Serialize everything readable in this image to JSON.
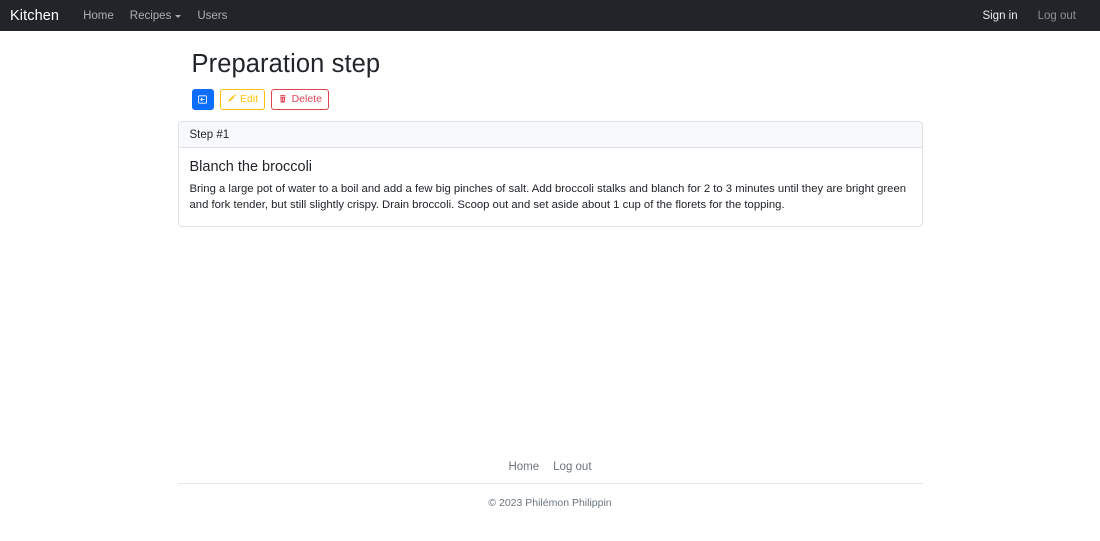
{
  "navbar": {
    "brand": "Kitchen",
    "links": [
      {
        "label": "Home",
        "icon": "",
        "has_caret": false
      },
      {
        "label": "Recipes",
        "icon": "chevron-down-icon",
        "has_caret": true
      },
      {
        "label": "Users",
        "icon": "",
        "has_caret": false
      }
    ],
    "right": [
      {
        "label": "Sign in",
        "state": "active"
      },
      {
        "label": "Log out",
        "state": "muted"
      }
    ],
    "background_color": "#212529"
  },
  "page": {
    "title": "Preparation step"
  },
  "actions": {
    "back_label": "",
    "back_icon": "box-arrow-left-icon",
    "edit_label": "Edit",
    "edit_icon": "pencil-icon",
    "delete_label": "Delete",
    "delete_icon": "trash-icon",
    "primary_color": "#0d6efd",
    "warning_color": "#ffc107",
    "danger_color": "#dc3545"
  },
  "card": {
    "header": "Step #1",
    "title": "Blanch the broccoli",
    "text": "Bring a large pot of water to a boil and add a few big pinches of salt. Add broccoli stalks and blanch for 2 to 3 minutes until they are bright green and fork tender, but still slightly crispy. Drain broccoli. Scoop out and set aside about 1 cup of the florets for the topping."
  },
  "footer": {
    "links": [
      {
        "label": "Home"
      },
      {
        "label": "Log out"
      }
    ],
    "copyright": "© 2023 Philémon Philippin"
  }
}
